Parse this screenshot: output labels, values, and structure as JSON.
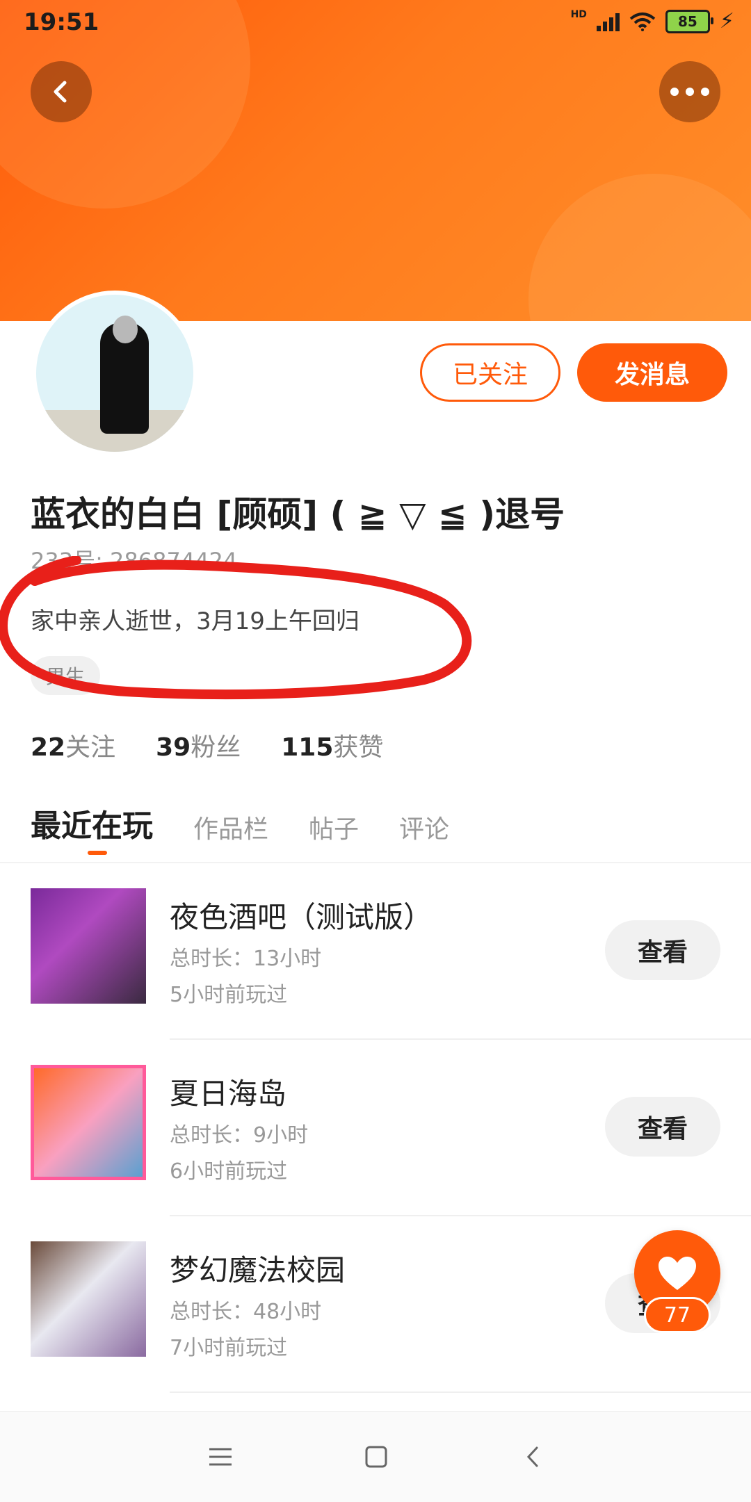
{
  "status_bar": {
    "time": "19:51",
    "network": "HD",
    "battery": "85"
  },
  "profile": {
    "name": "蓝衣的白白 [顾硕] ( ≧ ▽ ≦ )退号",
    "uid": "233号: 286874424",
    "bio": "家中亲人逝世，3月19上午回归",
    "gender": "男生",
    "follow_label": "已关注",
    "message_label": "发消息"
  },
  "stats": [
    {
      "num": "22",
      "label": "关注"
    },
    {
      "num": "39",
      "label": "粉丝"
    },
    {
      "num": "115",
      "label": "获赞"
    }
  ],
  "tabs": [
    "最近在玩",
    "作品栏",
    "帖子",
    "评论"
  ],
  "games": [
    {
      "title": "夜色酒吧（测试版）",
      "time": "总时长：13小时",
      "last": "5小时前玩过",
      "button": "查看"
    },
    {
      "title": "夏日海岛",
      "time": "总时长：9小时",
      "last": "6小时前玩过",
      "button": "查看"
    },
    {
      "title": "梦幻魔法校园",
      "time": "总时长：48小时",
      "last": "7小时前玩过",
      "button": "查看"
    }
  ],
  "likes": "77",
  "colors": {
    "accent": "#ff5a0a",
    "annotation": "#e8201a"
  },
  "icons": {
    "back": "chevron-left-icon",
    "more": "more-dots-icon",
    "like": "heart-icon"
  }
}
